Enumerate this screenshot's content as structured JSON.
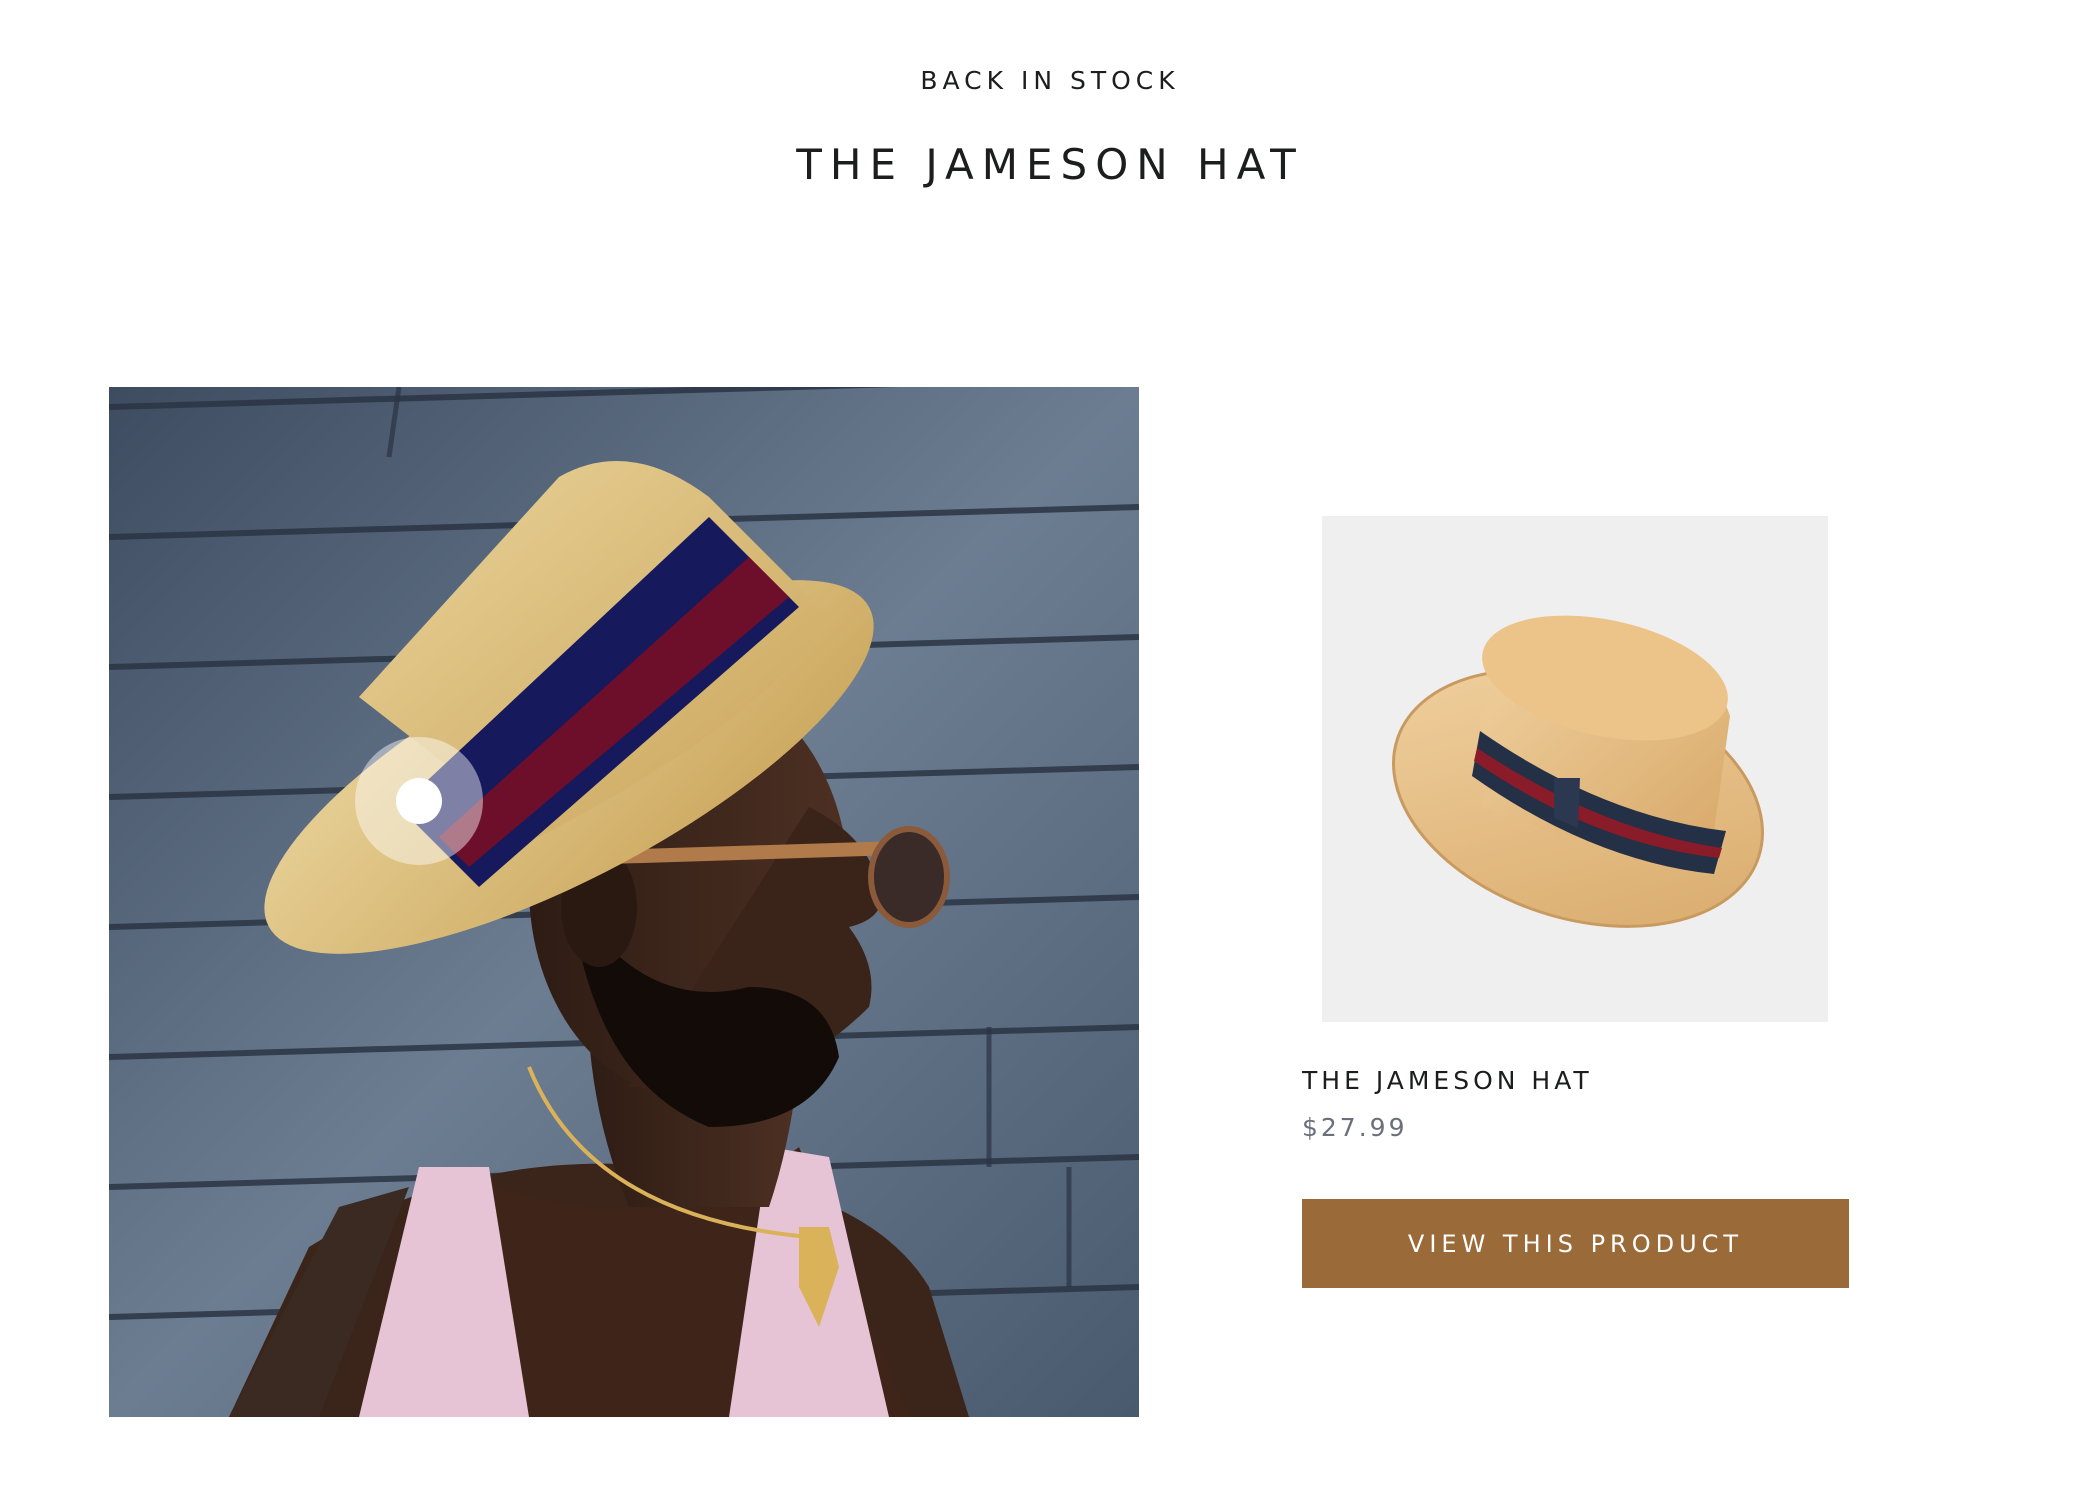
{
  "section": {
    "eyebrow": "BACK IN STOCK",
    "headline": "THE JAMESON HAT"
  },
  "lifestyle_image": {
    "alt": "Man wearing straw boater hat with navy and red band",
    "hotspot_label": "Product hotspot"
  },
  "product": {
    "title": "THE JAMESON HAT",
    "price": "$27.99",
    "cta_label": "VIEW THIS PRODUCT"
  },
  "colors": {
    "button_bg": "#9a6a39",
    "text_primary": "#1c1d1d",
    "price_text": "#6a6f7a",
    "product_bg": "#efefef"
  }
}
